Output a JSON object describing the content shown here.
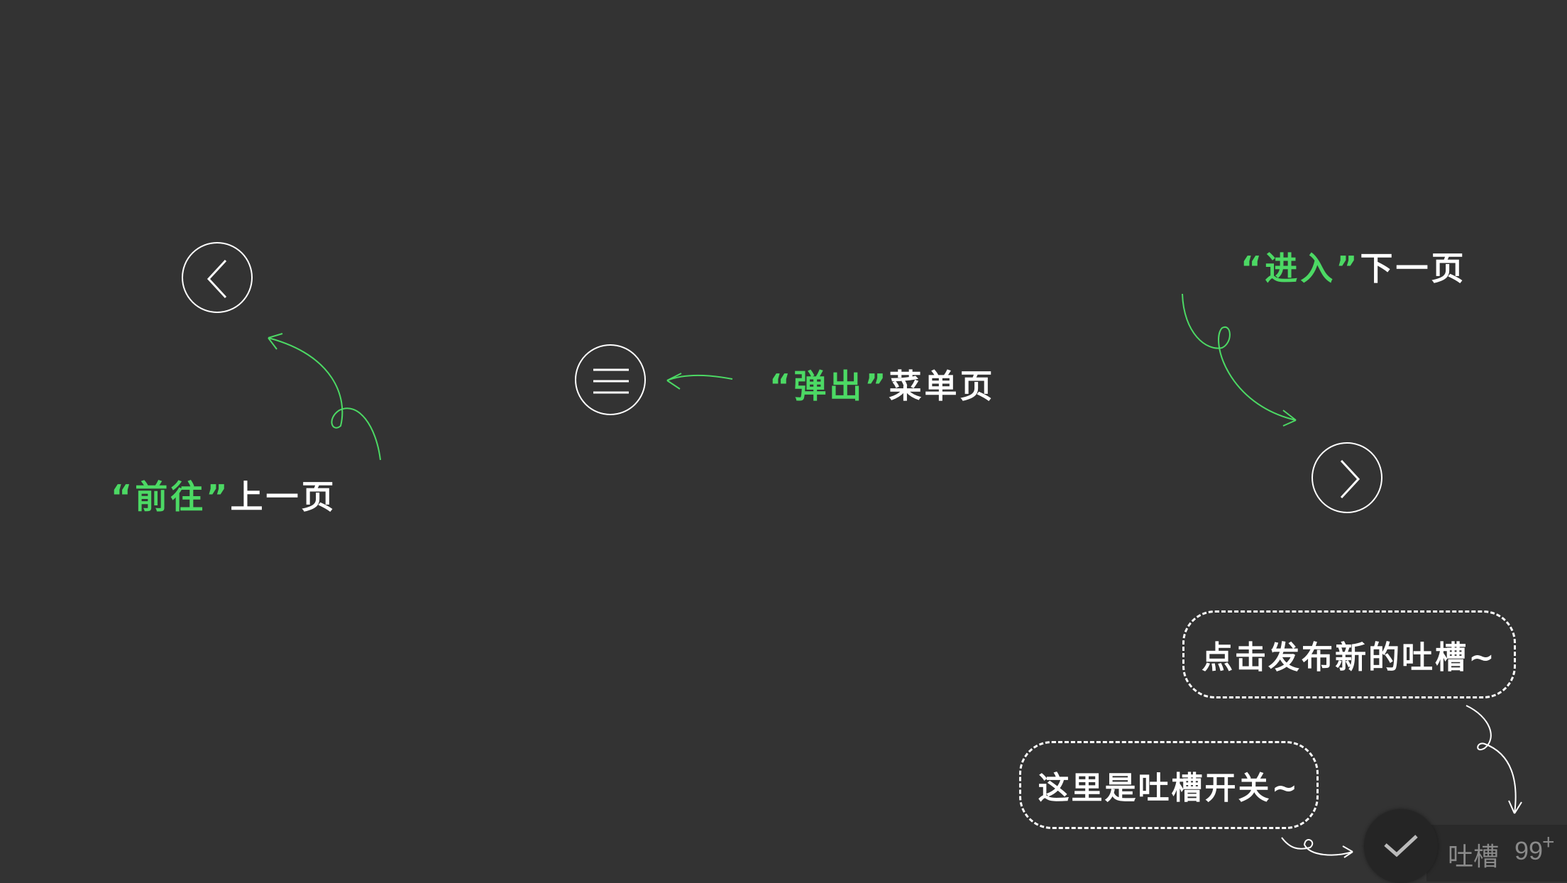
{
  "nav": {
    "prev": {
      "quote": "“前往”",
      "text": "上一页",
      "icon": "chevron-left-icon"
    },
    "menu": {
      "quote": "“弹出”",
      "text": "菜单页",
      "icon": "hamburger-menu-icon"
    },
    "next": {
      "quote": "“进入”",
      "text": "下一页",
      "icon": "chevron-right-icon"
    }
  },
  "hints": {
    "publish": "点击发布新的吐槽~",
    "toggle": "这里是吐槽开关~"
  },
  "tucao": {
    "label": "吐槽",
    "count": "99",
    "plus": "+",
    "icon": "checkmark-icon"
  },
  "colors": {
    "background": "#333333",
    "accent": "#4cd964",
    "text": "#ffffff",
    "muted": "#8a8a8a"
  }
}
